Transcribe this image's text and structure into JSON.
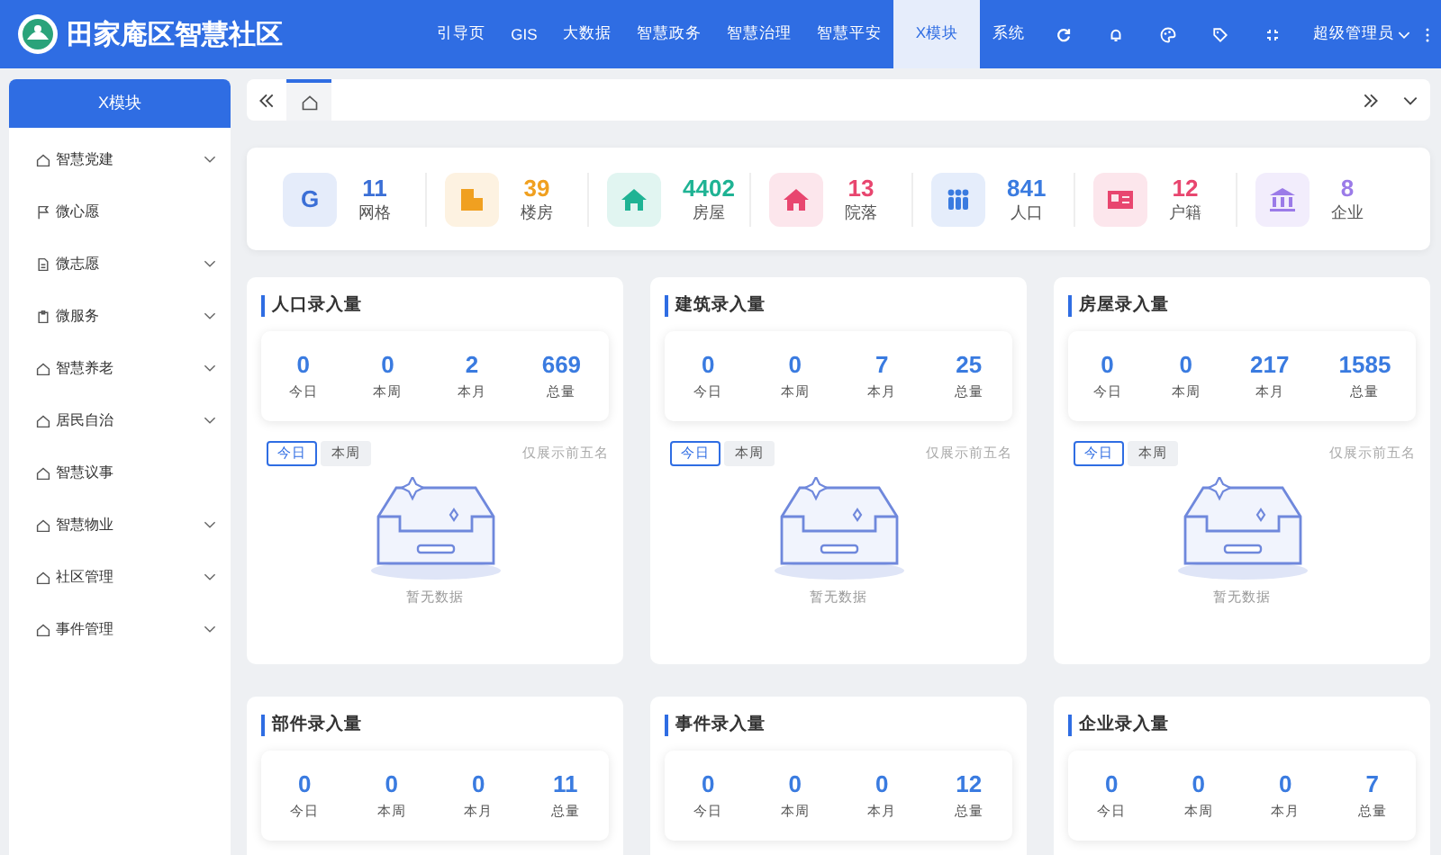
{
  "header": {
    "title": "田家庵区智慧社区",
    "nav": [
      {
        "label": "引导页",
        "selected": false
      },
      {
        "label": "GIS",
        "selected": false
      },
      {
        "label": "大数据",
        "selected": false
      },
      {
        "label": "智慧政务",
        "selected": false
      },
      {
        "label": "智慧治理",
        "selected": false
      },
      {
        "label": "智慧平安",
        "selected": false
      },
      {
        "label": "X模块",
        "selected": true
      },
      {
        "label": "系统",
        "selected": false
      }
    ],
    "user": "超级管理员"
  },
  "sidebar": {
    "title": "X模块",
    "items": [
      {
        "label": "智慧党建",
        "kind": "house",
        "expandable": true
      },
      {
        "label": "微心愿",
        "kind": "flag",
        "expandable": false
      },
      {
        "label": "微志愿",
        "kind": "document",
        "expandable": true
      },
      {
        "label": "微服务",
        "kind": "clipboard",
        "expandable": true
      },
      {
        "label": "智慧养老",
        "kind": "house",
        "expandable": true
      },
      {
        "label": "居民自治",
        "kind": "house",
        "expandable": true
      },
      {
        "label": "智慧议事",
        "kind": "house",
        "expandable": false
      },
      {
        "label": "智慧物业",
        "kind": "house",
        "expandable": true
      },
      {
        "label": "社区管理",
        "kind": "house",
        "expandable": true
      },
      {
        "label": "事件管理",
        "kind": "house",
        "expandable": true
      }
    ]
  },
  "summary": [
    {
      "kind": "letter",
      "icon_text": "G",
      "value": "11",
      "label": "网格",
      "color": "#3b6fd6"
    },
    {
      "kind": "building",
      "value": "39",
      "label": "楼房",
      "color": "#f0a020"
    },
    {
      "kind": "house",
      "value": "4402",
      "label": "房屋",
      "color": "#1fb394"
    },
    {
      "kind": "home",
      "value": "13",
      "label": "院落",
      "color": "#e8466f"
    },
    {
      "kind": "people",
      "value": "841",
      "label": "人口",
      "color": "#3a7be0"
    },
    {
      "kind": "card",
      "value": "12",
      "label": "户籍",
      "color": "#e8466f"
    },
    {
      "kind": "bank",
      "value": "8",
      "label": "企业",
      "color": "#9b7be8"
    }
  ],
  "cards": [
    {
      "title": "人口录入量",
      "stats": [
        {
          "value": "0",
          "label": "今日"
        },
        {
          "value": "0",
          "label": "本周"
        },
        {
          "value": "2",
          "label": "本月"
        },
        {
          "value": "669",
          "label": "总量"
        }
      ],
      "tabs": [
        {
          "label": "今日",
          "selected": true
        },
        {
          "label": "本周",
          "selected": false
        }
      ],
      "note": "仅展示前五名",
      "empty_text": "暂无数据"
    },
    {
      "title": "建筑录入量",
      "stats": [
        {
          "value": "0",
          "label": "今日"
        },
        {
          "value": "0",
          "label": "本周"
        },
        {
          "value": "7",
          "label": "本月"
        },
        {
          "value": "25",
          "label": "总量"
        }
      ],
      "tabs": [
        {
          "label": "今日",
          "selected": true
        },
        {
          "label": "本周",
          "selected": false
        }
      ],
      "note": "仅展示前五名",
      "empty_text": "暂无数据"
    },
    {
      "title": "房屋录入量",
      "stats": [
        {
          "value": "0",
          "label": "今日"
        },
        {
          "value": "0",
          "label": "本周"
        },
        {
          "value": "217",
          "label": "本月"
        },
        {
          "value": "1585",
          "label": "总量"
        }
      ],
      "tabs": [
        {
          "label": "今日",
          "selected": true
        },
        {
          "label": "本周",
          "selected": false
        }
      ],
      "note": "仅展示前五名",
      "empty_text": "暂无数据"
    },
    {
      "title": "部件录入量",
      "stats": [
        {
          "value": "0",
          "label": "今日"
        },
        {
          "value": "0",
          "label": "本周"
        },
        {
          "value": "0",
          "label": "本月"
        },
        {
          "value": "11",
          "label": "总量"
        }
      ]
    },
    {
      "title": "事件录入量",
      "stats": [
        {
          "value": "0",
          "label": "今日"
        },
        {
          "value": "0",
          "label": "本周"
        },
        {
          "value": "0",
          "label": "本月"
        },
        {
          "value": "12",
          "label": "总量"
        }
      ]
    },
    {
      "title": "企业录入量",
      "stats": [
        {
          "value": "0",
          "label": "今日"
        },
        {
          "value": "0",
          "label": "本周"
        },
        {
          "value": "0",
          "label": "本月"
        },
        {
          "value": "7",
          "label": "总量"
        }
      ]
    }
  ]
}
